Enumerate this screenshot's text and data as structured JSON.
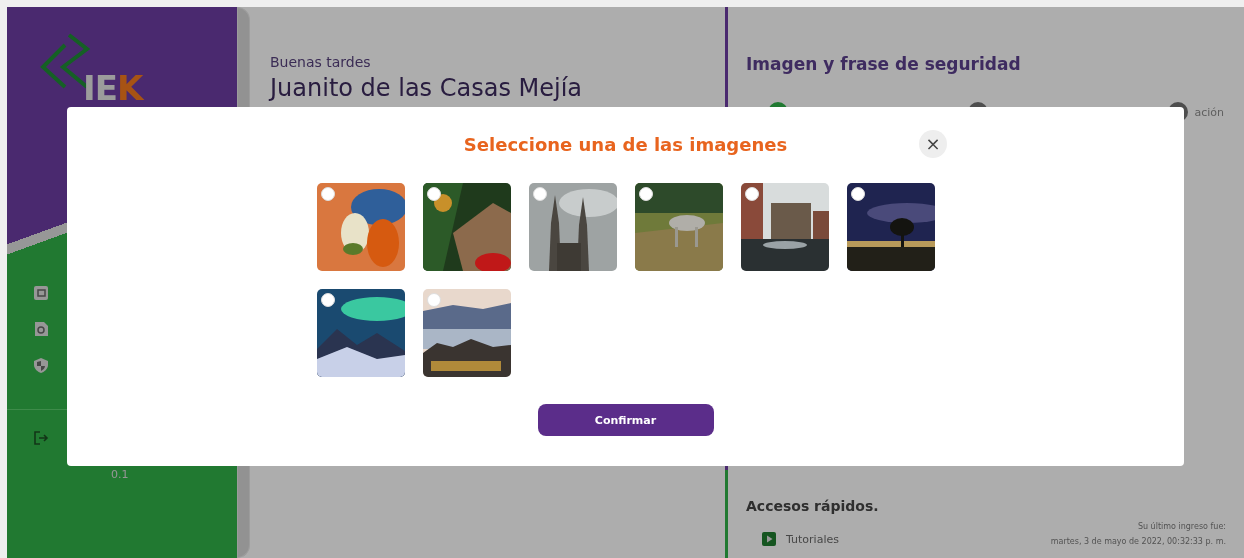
{
  "sidebar": {
    "logo": {
      "first": "IE",
      "accent": "K"
    },
    "nav_items": [
      {
        "kind": "wallet"
      },
      {
        "kind": "search-doc"
      },
      {
        "kind": "shield"
      }
    ],
    "logout": {
      "kind": "logout"
    },
    "version": "0.1"
  },
  "greeting": {
    "salutation": "Buenas tardes",
    "name": "Juanito de las Casas Mejía"
  },
  "security_panel": {
    "title": "Imagen y frase de seguridad",
    "steps": [
      {
        "done": true
      },
      {
        "done": false
      },
      {
        "done": false,
        "label": "ación"
      }
    ]
  },
  "quick_access": {
    "title": "Accesos rápidos.",
    "items": [
      {
        "label": "Tutoriales"
      }
    ]
  },
  "last_login": {
    "label": "Su último ingreso fue:",
    "value": "martes, 3 de mayo de 2022, 00:32:33 p. m."
  },
  "modal": {
    "title": "Seleccione una de las imagenes",
    "close": "×",
    "confirm": "Confirmar"
  }
}
